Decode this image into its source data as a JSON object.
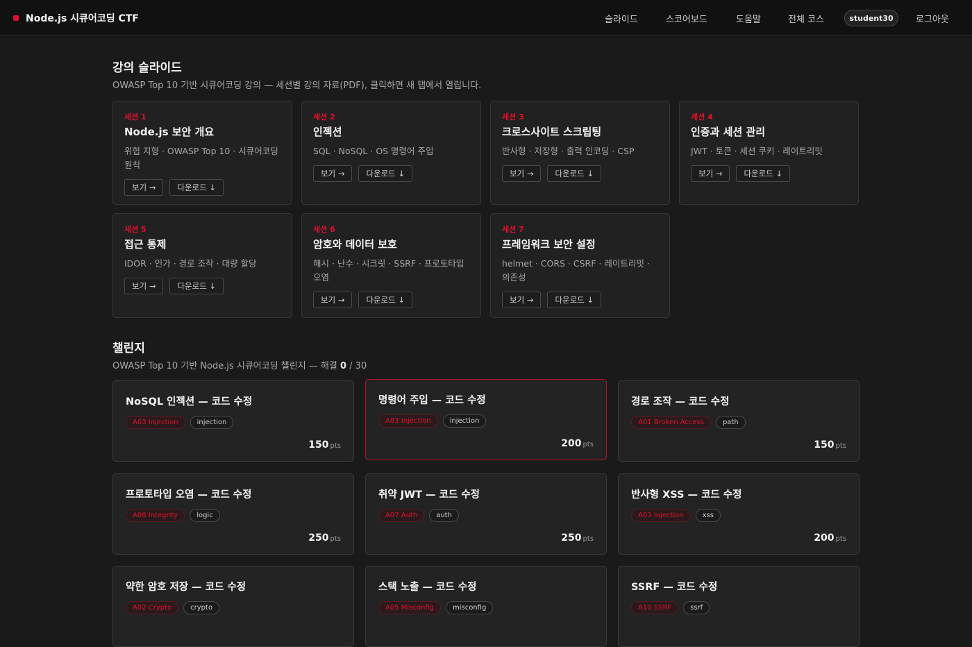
{
  "header": {
    "brand": "Node.js 시큐어코딩 CTF",
    "nav": [
      "슬라이드",
      "스코어보드",
      "도움말",
      "전체 코스"
    ],
    "user": "student30",
    "logout": "로그아웃"
  },
  "slides_section": {
    "title": "강의 슬라이드",
    "subtitle": "OWASP Top 10 기반 시큐어코딩 강의 — 세션별 강의 자료(PDF), 클릭하면 새 탭에서 열립니다.",
    "view_label": "보기 →",
    "download_label": "다운로드 ↓",
    "items": [
      {
        "session": "세션 1",
        "title": "Node.js 보안 개요",
        "desc": "위협 지형 · OWASP Top 10 · 시큐어코딩 원칙"
      },
      {
        "session": "세션 2",
        "title": "인젝션",
        "desc": "SQL · NoSQL · OS 명령어 주입"
      },
      {
        "session": "세션 3",
        "title": "크로스사이트 스크립팅",
        "desc": "반사형 · 저장형 · 출력 인코딩 · CSP"
      },
      {
        "session": "세션 4",
        "title": "인증과 세션 관리",
        "desc": "JWT · 토큰 · 세션 쿠키 · 레이트리밋"
      },
      {
        "session": "세션 5",
        "title": "접근 통제",
        "desc": "IDOR · 인가 · 경로 조작 · 대량 할당"
      },
      {
        "session": "세션 6",
        "title": "암호와 데이터 보호",
        "desc": "해시 · 난수 · 시크릿 · SSRF · 프로토타입 오염"
      },
      {
        "session": "세션 7",
        "title": "프레임워크 보안 설정",
        "desc": "helmet · CORS · CSRF · 레이트리밋 · 의존성"
      }
    ]
  },
  "challenges_section": {
    "title": "챌린지",
    "subtitle_prefix": "OWASP Top 10 기반 Node.js 시큐어코딩 챌린지 — 해결 ",
    "solved": "0",
    "total_suffix": " / 30",
    "pts_unit": "pts",
    "items": [
      {
        "title": "NoSQL 인젝션 — 코드 수정",
        "owasp": "A03 Injection",
        "category": "injection",
        "points": "150"
      },
      {
        "title": "명령어 주입 — 코드 수정",
        "owasp": "A03 Injection",
        "category": "injection",
        "points": "200"
      },
      {
        "title": "경로 조작 — 코드 수정",
        "owasp": "A01 Broken Access",
        "category": "path",
        "points": "150"
      },
      {
        "title": "프로토타입 오염 — 코드 수정",
        "owasp": "A08 Integrity",
        "category": "logic",
        "points": "250"
      },
      {
        "title": "취약 JWT — 코드 수정",
        "owasp": "A07 Auth",
        "category": "auth",
        "points": "250"
      },
      {
        "title": "반사형 XSS — 코드 수정",
        "owasp": "A03 Injection",
        "category": "xss",
        "points": "200"
      },
      {
        "title": "약한 암호 저장 — 코드 수정",
        "owasp": "A02 Crypto",
        "category": "crypto",
        "points": ""
      },
      {
        "title": "스택 노출 — 코드 수정",
        "owasp": "A05 Misconfig",
        "category": "misconfig",
        "points": ""
      },
      {
        "title": "SSRF — 코드 수정",
        "owasp": "A10 SSRF",
        "category": "ssrf",
        "points": ""
      }
    ]
  },
  "colors": {
    "accent": "#e0102c",
    "background": "#1a1a1a",
    "card": "#212121"
  }
}
